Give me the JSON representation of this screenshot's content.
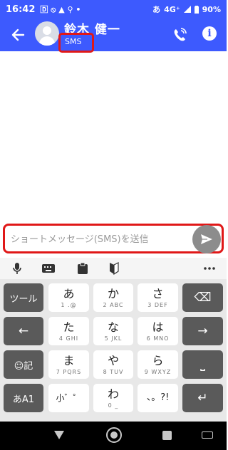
{
  "status_bar": {
    "time": "16:42",
    "notification_icons": "🄳 ⦸ ▲ ⚲ •",
    "input_mode": "あ",
    "network": "4G⁺",
    "battery": "90%"
  },
  "header": {
    "contact_name": "鈴木 健一",
    "channel_label": "SMS"
  },
  "compose": {
    "placeholder": "ショートメッセージ(SMS)を送信",
    "value": ""
  },
  "keyboard": {
    "rows": [
      {
        "left": "ツール",
        "keys": [
          {
            "kana": "あ",
            "sub": "1 .@"
          },
          {
            "kana": "か",
            "sub": "2 ABC"
          },
          {
            "kana": "さ",
            "sub": "3 DEF"
          }
        ],
        "right": "⌫"
      },
      {
        "left": "←",
        "keys": [
          {
            "kana": "た",
            "sub": "4 GHI"
          },
          {
            "kana": "な",
            "sub": "5 JKL"
          },
          {
            "kana": "は",
            "sub": "6 MNO"
          }
        ],
        "right": "→"
      },
      {
        "left": "☺記",
        "keys": [
          {
            "kana": "ま",
            "sub": "7 PQRS"
          },
          {
            "kana": "や",
            "sub": "8 TUV"
          },
          {
            "kana": "ら",
            "sub": "9 WXYZ"
          }
        ],
        "right": "⎵"
      },
      {
        "left": "あA1",
        "keys": [
          {
            "kana": "小゛゜",
            "sub": ""
          },
          {
            "kana": "わ",
            "sub": "0 _"
          },
          {
            "kana": "、。?!",
            "sub": ""
          }
        ],
        "right": "↵"
      }
    ]
  },
  "icons": {
    "back": "arrow-left-icon",
    "call": "phone-call-icon",
    "info": "info-icon",
    "send": "send-icon",
    "mic": "microphone-icon",
    "keyboard": "keyboard-icon",
    "clipboard": "clipboard-icon",
    "beginner": "beginner-mark-icon",
    "more": "more-icon"
  },
  "colors": {
    "header": "#3d5afe",
    "highlight": "#e01818",
    "send_button": "#8c8c8c",
    "dark_key": "#5a5a5a"
  }
}
